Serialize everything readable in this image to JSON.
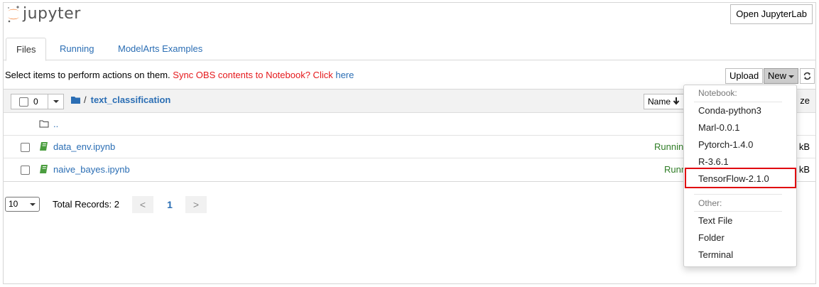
{
  "app": {
    "logo_text": "jupyter",
    "open_jupyterlab": "Open JupyterLab"
  },
  "tabs": [
    {
      "label": "Files",
      "active": true
    },
    {
      "label": "Running",
      "active": false
    },
    {
      "label": "ModelArts Examples",
      "active": false
    }
  ],
  "toolbar": {
    "message": "Select items to perform actions on them. ",
    "sync_text": "Sync OBS contents to Notebook? Click ",
    "here_link": "here",
    "upload_label": "Upload",
    "new_label": "New",
    "refresh_icon": "refresh-icon"
  },
  "list": {
    "selected_count": "0",
    "breadcrumb_root": "/",
    "breadcrumb_folder": "text_classification",
    "sort_label": "Name",
    "sort_icon": "arrow-down-icon",
    "partial_header_text": "ze",
    "parent_dir": "..",
    "rows": [
      {
        "name": "data_env.ipynb",
        "status": "Runnin",
        "size": "kB"
      },
      {
        "name": "naive_bayes.ipynb",
        "status": "Runn",
        "size": "kB"
      }
    ]
  },
  "pagination": {
    "page_size": "10",
    "total_records": "Total Records: 2",
    "prev": "<",
    "current_page": "1",
    "next": ">"
  },
  "new_menu": {
    "notebook_header": "Notebook:",
    "kernels": [
      "Conda-python3",
      "Marl-0.0.1",
      "Pytorch-1.4.0",
      "R-3.6.1",
      "TensorFlow-2.1.0"
    ],
    "highlighted": "TensorFlow-2.1.0",
    "other_header": "Other:",
    "other_items": [
      "Text File",
      "Folder",
      "Terminal"
    ]
  },
  "colors": {
    "link": "#2b6eb4",
    "warning": "#e5191c",
    "running": "#2f7d26",
    "highlight_border": "#e0000f",
    "notebook_icon": "#4a9d3e",
    "folder_icon": "#2b6eb4",
    "logo_orange": "#f37726"
  }
}
